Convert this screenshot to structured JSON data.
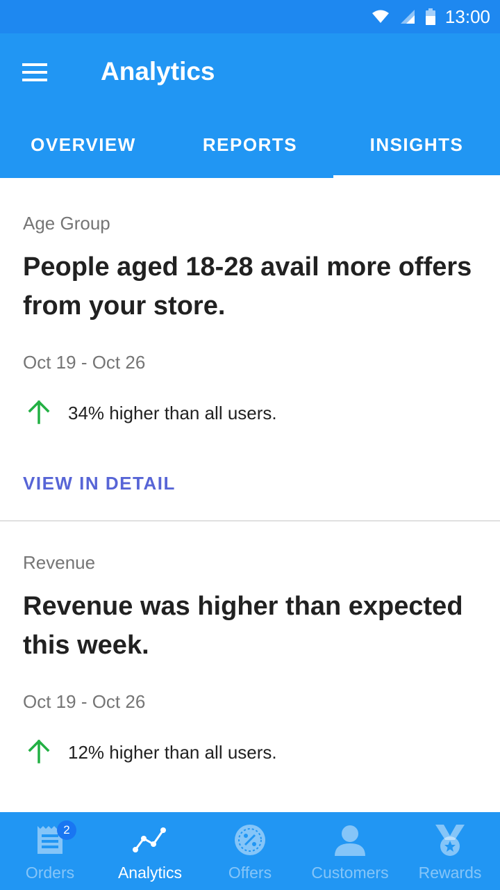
{
  "status_bar": {
    "time": "13:00"
  },
  "app_bar": {
    "title": "Analytics"
  },
  "tabs": [
    {
      "label": "OVERVIEW",
      "active": false
    },
    {
      "label": "REPORTS",
      "active": false
    },
    {
      "label": "INSIGHTS",
      "active": true
    }
  ],
  "insights": [
    {
      "category": "Age Group",
      "headline": "People aged 18-28 avail more offers from your store.",
      "date_range": "Oct 19 - Oct 26",
      "stat_text": "34% higher than all users.",
      "link_label": "VIEW IN DETAIL"
    },
    {
      "category": "Revenue",
      "headline": "Revenue was higher than expected this week.",
      "date_range": "Oct 19 - Oct 26",
      "stat_text": "12% higher than all users."
    }
  ],
  "bottom_nav": [
    {
      "label": "Orders",
      "icon": "orders-icon",
      "badge": "2",
      "active": false
    },
    {
      "label": "Analytics",
      "icon": "analytics-icon",
      "active": true
    },
    {
      "label": "Offers",
      "icon": "offers-icon",
      "active": false
    },
    {
      "label": "Customers",
      "icon": "customers-icon",
      "active": false
    },
    {
      "label": "Rewards",
      "icon": "rewards-icon",
      "active": false
    }
  ],
  "colors": {
    "primary": "#2196f3",
    "status_bar": "#1e88f0",
    "link": "#5765d6",
    "positive_arrow": "#22b043",
    "badge": "#1976f2"
  }
}
